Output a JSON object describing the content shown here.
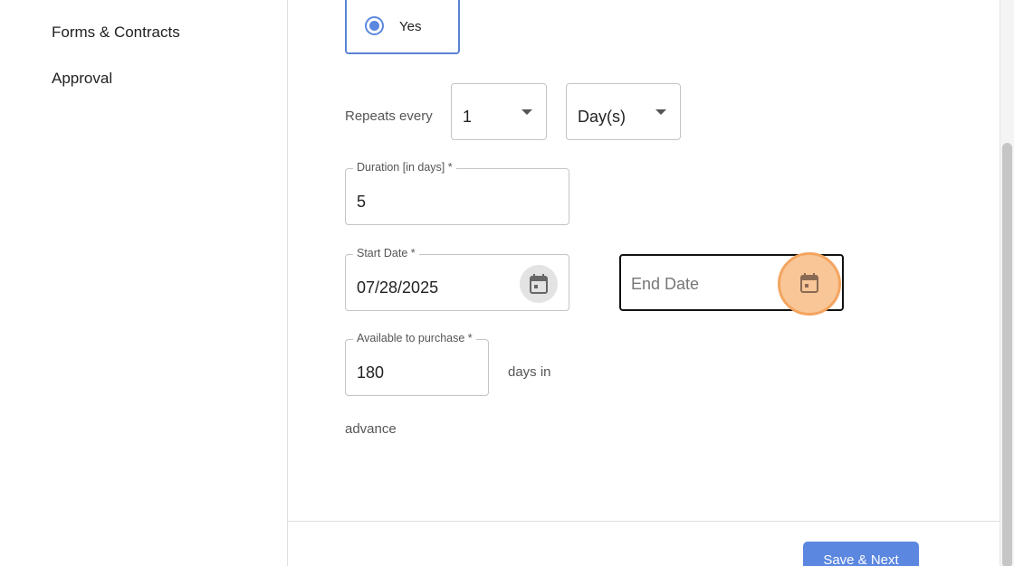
{
  "sidebar": {
    "items": [
      {
        "label": "Forms & Contracts"
      },
      {
        "label": "Approval"
      }
    ]
  },
  "form": {
    "yes_option": {
      "label": "Yes",
      "selected": true
    },
    "repeats": {
      "label": "Repeats every",
      "count_value": "1",
      "unit_value": "Day(s)"
    },
    "duration": {
      "label": "Duration [in days] *",
      "value": "5"
    },
    "start_date": {
      "label": "Start Date *",
      "value": "07/28/2025",
      "icon": "calendar-icon"
    },
    "end_date": {
      "placeholder": "End Date",
      "icon": "calendar-icon"
    },
    "available": {
      "label": "Available to purchase *",
      "value": "180",
      "suffix": "days in",
      "suffix2": "advance"
    }
  },
  "footer": {
    "save_label": "Save & Next"
  },
  "colors": {
    "accent": "#5b87e0",
    "highlight": "#f9c697",
    "highlight_border": "#f3a560"
  }
}
